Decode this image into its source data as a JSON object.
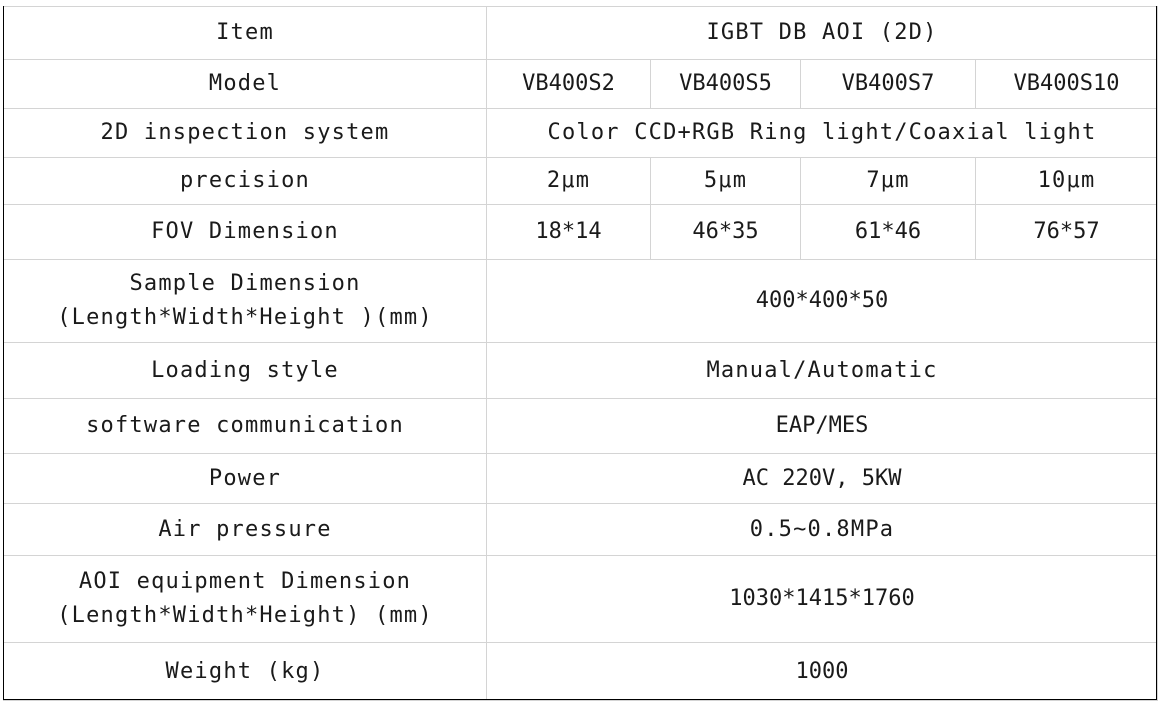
{
  "table": {
    "header": {
      "label": "Item",
      "value": "IGBT DB AOI (2D)"
    },
    "model": {
      "label": "Model",
      "values": [
        "VB400S2",
        "VB400S5",
        "VB400S7",
        "VB400S10"
      ]
    },
    "inspection_system": {
      "label": "2D inspection system",
      "value": "Color CCD+RGB Ring light/Coaxial light"
    },
    "precision": {
      "label": "precision",
      "values": [
        "2μm",
        "5μm",
        "7μm",
        "10μm"
      ]
    },
    "fov_dimension": {
      "label": "FOV Dimension",
      "values": [
        "18*14",
        "46*35",
        "61*46",
        "76*57"
      ]
    },
    "sample_dimension": {
      "label_line1": "Sample Dimension",
      "label_line2": "(Length*Width*Height )(mm)",
      "value": "400*400*50"
    },
    "loading_style": {
      "label": "Loading style",
      "value": "Manual/Automatic"
    },
    "software_communication": {
      "label": "software communication",
      "value": "EAP/MES"
    },
    "power": {
      "label": "Power",
      "value": "AC 220V, 5KW"
    },
    "air_pressure": {
      "label": "Air pressure",
      "value": "0.5~0.8MPa"
    },
    "equipment_dimension": {
      "label_line1": "AOI equipment Dimension",
      "label_line2": "(Length*Width*Height) (mm)",
      "value": "1030*1415*1760"
    },
    "weight": {
      "label": "Weight (kg)",
      "value": "1000"
    }
  }
}
